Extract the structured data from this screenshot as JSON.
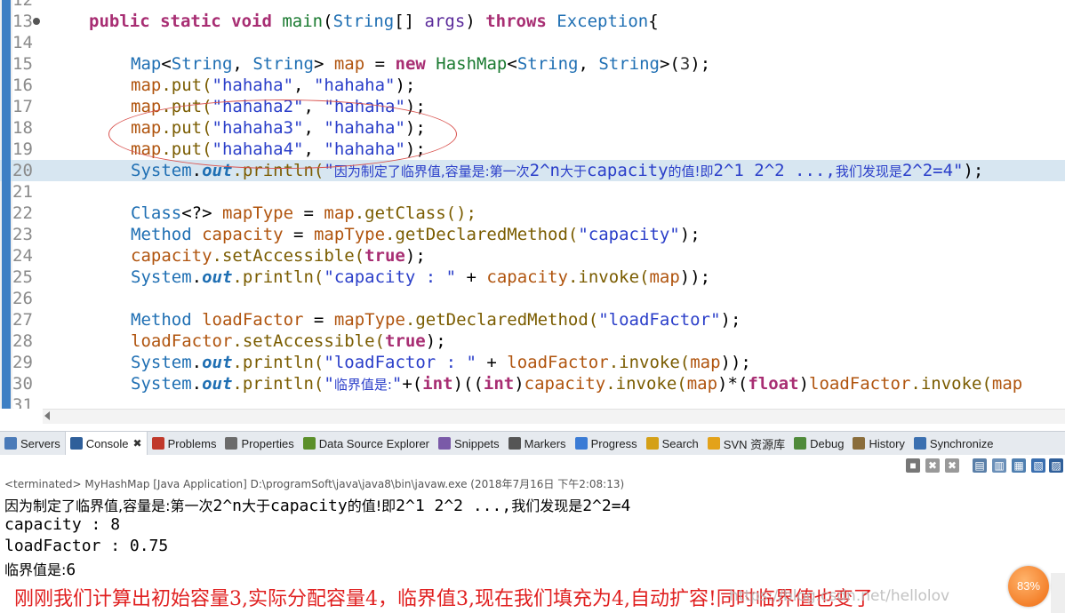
{
  "editor": {
    "lines": [
      {
        "n": "12"
      },
      {
        "n": "13"
      },
      {
        "n": "14"
      },
      {
        "n": "15"
      },
      {
        "n": "16"
      },
      {
        "n": "17"
      },
      {
        "n": "18"
      },
      {
        "n": "19"
      },
      {
        "n": "20"
      },
      {
        "n": "21"
      },
      {
        "n": "22"
      },
      {
        "n": "23"
      },
      {
        "n": "24"
      },
      {
        "n": "25"
      },
      {
        "n": "26"
      },
      {
        "n": "27"
      },
      {
        "n": "28"
      },
      {
        "n": "29"
      },
      {
        "n": "30"
      },
      {
        "n": "31"
      }
    ],
    "code": {
      "l13": {
        "kw1": "public static void",
        "fn": "main",
        "p1": "(",
        "type": "String",
        "p2": "[] ",
        "arg": "args",
        "p3": ") ",
        "kw2": "throws",
        "sp": " ",
        "exc": "Exception",
        "p4": "{"
      },
      "l15": {
        "t1": "Map",
        "p1": "<",
        "t2": "String",
        "p2": ", ",
        "t3": "String",
        "p3": "> ",
        "v": "map",
        "p4": " = ",
        "kw": "new",
        "sp": " ",
        "t4": "HashMap",
        "p5": "<",
        "t5": "String",
        "p6": ", ",
        "t6": "String",
        "p7": ">(",
        "n": "3",
        "p8": ");"
      },
      "l16": {
        "v": "map",
        "m": ".put(",
        "s1": "\"hahaha\"",
        "c": ", ",
        "s2": "\"hahaha\"",
        "e": ");"
      },
      "l17": {
        "v": "map",
        "m": ".put(",
        "s1": "\"hahaha2\"",
        "c": ", ",
        "s2": "\"hahaha\"",
        "e": ");"
      },
      "l18": {
        "v": "map",
        "m": ".put(",
        "s1": "\"hahaha3\"",
        "c": ", ",
        "s2": "\"hahaha\"",
        "e": ");"
      },
      "l19": {
        "v": "map",
        "m": ".put(",
        "s1": "\"hahaha4\"",
        "c": ", ",
        "s2": "\"hahaha\"",
        "e": ");"
      },
      "l20": {
        "cls": "System",
        "dot": ".",
        "fld": "out",
        "m": ".println(",
        "q1": "\"",
        "cjk1": "因为制定了临界值,容量是:第一次",
        "s1": "2^n",
        "cjk2": "大于",
        "s2": "capacity",
        "cjk3": "的值!即",
        "s3": "2^1 2^2 ...,",
        "cjk4": "我们发现是",
        "s4": "2^2=4\"",
        "e": ");"
      },
      "l22": {
        "t1": "Class",
        "p1": "<?> ",
        "v": "mapType",
        "p2": " = ",
        "v2": "map",
        "m": ".getClass();"
      },
      "l23": {
        "t1": "Method",
        "sp": " ",
        "v": "capacity",
        "p1": " = ",
        "v2": "mapType",
        "m": ".getDeclaredMethod(",
        "s": "\"capacity\"",
        "e": ");"
      },
      "l24": {
        "v": "capacity",
        "m": ".setAccessible(",
        "kw": "true",
        "e": ");"
      },
      "l25": {
        "cls": "System",
        "dot": ".",
        "fld": "out",
        "m": ".println(",
        "s": "\"capacity : \"",
        "p": " + ",
        "v": "capacity",
        "m2": ".invoke(",
        "v2": "map",
        "e": "));"
      },
      "l27": {
        "t1": "Method",
        "sp": " ",
        "v": "loadFactor",
        "p1": " = ",
        "v2": "mapType",
        "m": ".getDeclaredMethod(",
        "s": "\"loadFactor\"",
        "e": ");"
      },
      "l28": {
        "v": "loadFactor",
        "m": ".setAccessible(",
        "kw": "true",
        "e": ");"
      },
      "l29": {
        "cls": "System",
        "dot": ".",
        "fld": "out",
        "m": ".println(",
        "s": "\"loadFactor : \"",
        "p": " + ",
        "v": "loadFactor",
        "m2": ".invoke(",
        "v2": "map",
        "e": "));"
      },
      "l30": {
        "cls": "System",
        "dot": ".",
        "fld": "out",
        "m": ".println(",
        "q": "\"",
        "cjk": "临界值是:",
        "q2": "\"",
        "p1": "+(",
        "kw1": "int",
        "p2": ")((",
        "kw2": "int",
        "p3": ")",
        "v": "capacity",
        "m2": ".invoke(",
        "v2": "map",
        "p4": ")*(",
        "kw3": "float",
        "p5": ")",
        "v3": "loadFactor",
        "m3": ".invoke(",
        "tail": "map"
      }
    }
  },
  "tabs": [
    {
      "label": "Servers",
      "icon": "servers-icon",
      "color": "#4a7ab8"
    },
    {
      "label": "Console",
      "icon": "console-icon",
      "color": "#2f5f9a",
      "close": "✖"
    },
    {
      "label": "Problems",
      "icon": "problems-icon",
      "color": "#c0392b"
    },
    {
      "label": "Properties",
      "icon": "properties-icon",
      "color": "#6b6b6b"
    },
    {
      "label": "Data Source Explorer",
      "icon": "data-source-explorer-icon",
      "color": "#5b8f2a"
    },
    {
      "label": "Snippets",
      "icon": "snippets-icon",
      "color": "#7a5aa8"
    },
    {
      "label": "Markers",
      "icon": "markers-icon",
      "color": "#555555"
    },
    {
      "label": "Progress",
      "icon": "progress-icon",
      "color": "#3a7bd5"
    },
    {
      "label": "Search",
      "icon": "search-icon",
      "color": "#d4a017"
    },
    {
      "label": "SVN 资源库",
      "icon": "svn-repository-icon",
      "color": "#e3a21a"
    },
    {
      "label": "Debug",
      "icon": "debug-icon",
      "color": "#4f8a3a"
    },
    {
      "label": "History",
      "icon": "history-icon",
      "color": "#8a6d3b"
    },
    {
      "label": "Synchronize",
      "icon": "synchronize-icon",
      "color": "#3a6fb0"
    }
  ],
  "console": {
    "status": "<terminated> MyHashMap [Java Application] D:\\programSoft\\java\\java8\\bin\\javaw.exe (2018年7月16日 下午2:08:13)",
    "output": [
      {
        "a": "因为制定了临界值,容量是:第一次",
        "b": "2^n",
        "c": "大于",
        "d": "capacity",
        "e": "的值!即",
        "f": "2^1 2^2 ...,",
        "g": "我们发现是",
        "h": "2^2=4"
      },
      {
        "text": "capacity : 8"
      },
      {
        "text": "loadFactor : 0.75"
      },
      {
        "a": "临界值是:",
        "b": "6"
      }
    ]
  },
  "annotation": "刚刚我们计算出初始容量3,实际分配容量4，临界值3,现在我们填充为4,自动扩容!同时临界值也变了",
  "watermark": "https://blog.csdn.net/hellolov",
  "badge": "83%"
}
